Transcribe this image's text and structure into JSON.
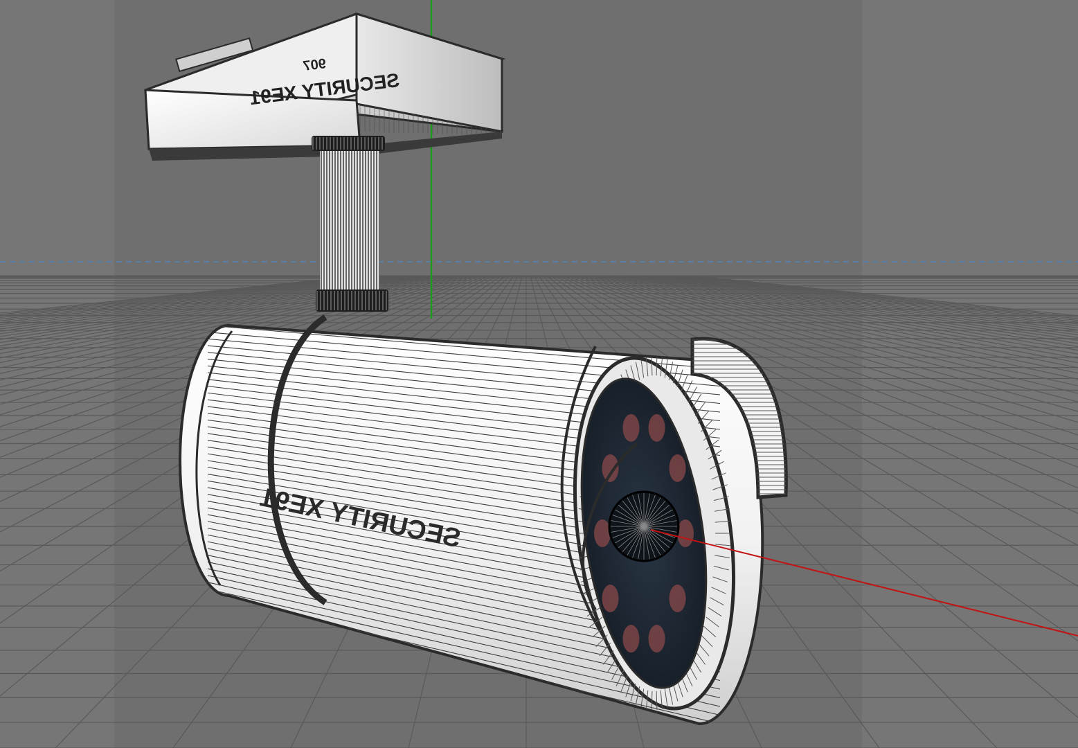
{
  "viewport": {
    "background": "#6f6f6f",
    "safe_frame_color": "#737373",
    "horizon_color": "#5a7fa8",
    "axis_y_color": "#1f9a1f",
    "axis_x_color": "#c21414"
  },
  "model": {
    "mount_label_main": "SECURITY XE91",
    "mount_label_small": "907",
    "body_label": "SECURITY XE91",
    "body_fill": "#f2f2f2",
    "lens_fill": "#1b2430",
    "led_color": "#8a4a4a"
  }
}
